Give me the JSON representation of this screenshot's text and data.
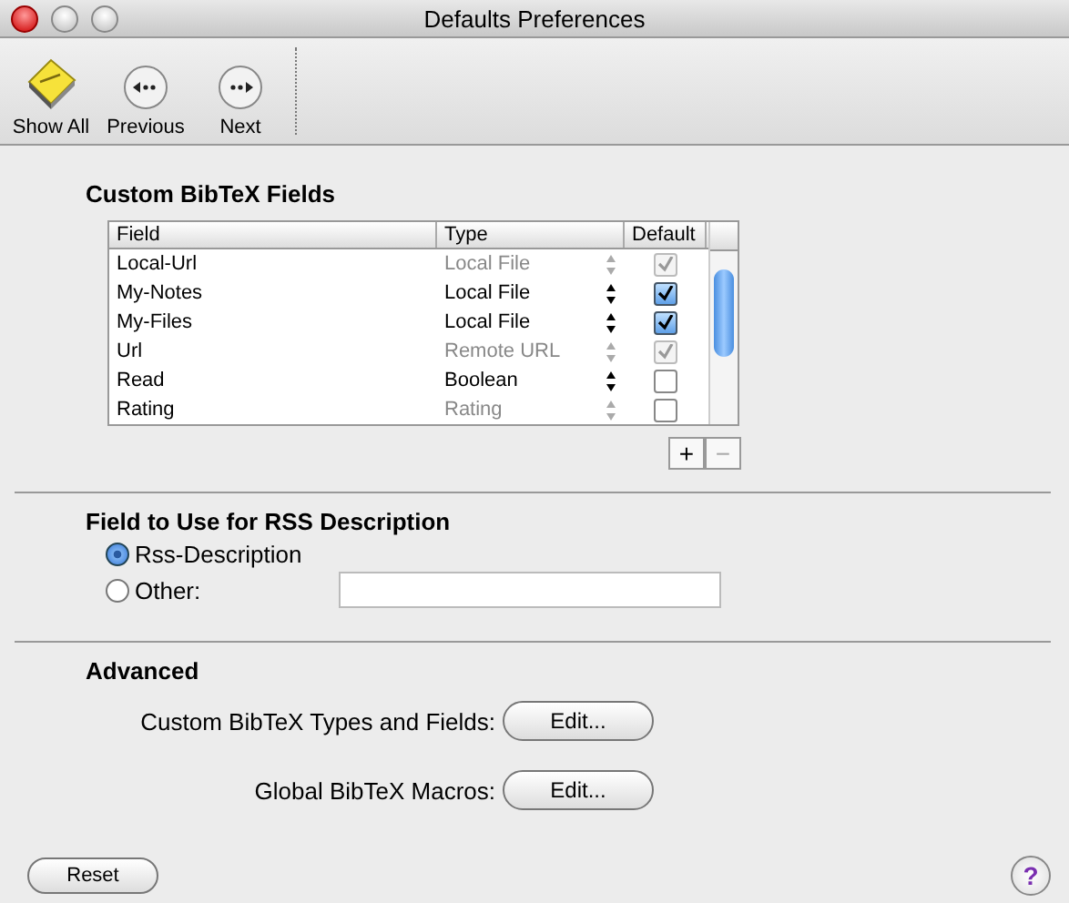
{
  "window": {
    "title": "Defaults Preferences"
  },
  "toolbar": [
    {
      "kind": "showall",
      "label": "Show All"
    },
    {
      "kind": "previous",
      "label": "Previous"
    },
    {
      "kind": "next",
      "label": "Next"
    }
  ],
  "custom_fields": {
    "title": "Custom BibTeX Fields",
    "columns": [
      "Field",
      "Type",
      "Default"
    ],
    "rows": [
      {
        "field": "Local-Url",
        "type": "Local File",
        "disabled": true,
        "checked": true
      },
      {
        "field": "My-Notes",
        "type": "Local File",
        "disabled": false,
        "checked": true
      },
      {
        "field": "My-Files",
        "type": "Local File",
        "disabled": false,
        "checked": true
      },
      {
        "field": "Url",
        "type": "Remote URL",
        "disabled": true,
        "checked": true
      },
      {
        "field": "Read",
        "type": "Boolean",
        "disabled": false,
        "checked": false
      },
      {
        "field": "Rating",
        "type": "Rating",
        "disabled": true,
        "checked": false
      }
    ],
    "add_button": "+",
    "remove_button": "−"
  },
  "rss": {
    "title": "Field to Use for RSS Description",
    "options": [
      {
        "label": "Rss-Description",
        "selected": true
      },
      {
        "label": "Other:",
        "selected": false
      }
    ]
  },
  "advanced": {
    "title": "Advanced",
    "rows": [
      {
        "label": "Custom BibTeX Types and Fields:",
        "button": "Edit..."
      },
      {
        "label": "Global BibTeX Macros:",
        "button": "Edit..."
      }
    ]
  },
  "reset_button": "Reset",
  "help_button": "?"
}
